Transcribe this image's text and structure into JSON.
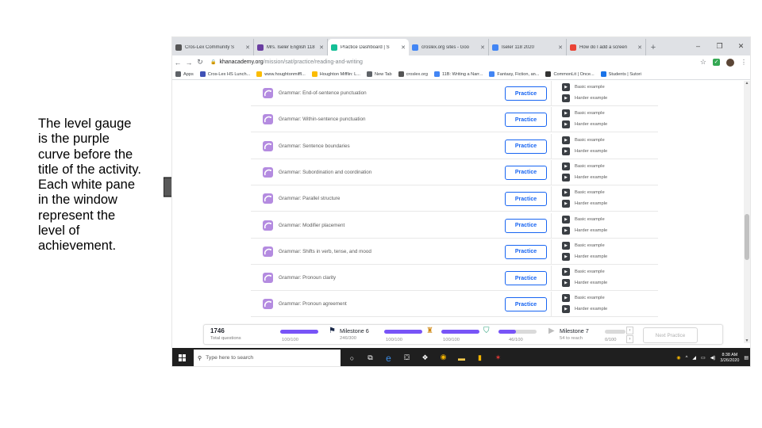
{
  "annotation": {
    "lines": [
      "The level gauge",
      "is the purple",
      "curve before the",
      "title of the activity.",
      "Each white pane",
      "in the window",
      "represent the",
      "level of",
      "achievement."
    ]
  },
  "browser": {
    "tabs": [
      {
        "title": "Cros-Lex Community S",
        "color": "#555555"
      },
      {
        "title": "Mrs. Iseler English 118",
        "color": "#6a3ea1"
      },
      {
        "title": "Practice Dashboard | S",
        "color": "#14bf96",
        "active": true
      },
      {
        "title": "croslex.org sites - Goo",
        "color": "#4285f4"
      },
      {
        "title": "Iseler 118 2020",
        "color": "#4285f4"
      },
      {
        "title": "How do I add a screen",
        "color": "#ea4335"
      }
    ],
    "new_tab": "+",
    "window_controls": [
      "–",
      "❐",
      "✕"
    ],
    "url_host": "khanacademy.org",
    "url_path": "/mission/sat/practice/reading-and-writing",
    "bookmarks": [
      {
        "label": "Apps",
        "color": "#5f6368"
      },
      {
        "label": "Cros-Lex HS Lunch...",
        "color": "#3f51b5"
      },
      {
        "label": "www.houghtonmiffl...",
        "color": "#fbbc04"
      },
      {
        "label": "Houghton Mifflin: L...",
        "color": "#fbbc04"
      },
      {
        "label": "New Tab",
        "color": "#5f6368"
      },
      {
        "label": "croslex.org",
        "color": "#555555"
      },
      {
        "label": "11B: Writing a Narr...",
        "color": "#4285f4"
      },
      {
        "label": "Fantasy, Fiction, an...",
        "color": "#4285f4"
      },
      {
        "label": "CommonLit | Once...",
        "color": "#333333"
      },
      {
        "label": "Students | Sutori",
        "color": "#1a73e8"
      }
    ]
  },
  "practice": {
    "button_label": "Practice",
    "example_basic": "Basic example",
    "example_harder": "Harder example",
    "skills": [
      "Grammar: End-of-sentence punctuation",
      "Grammar: Within-sentence punctuation",
      "Grammar: Sentence boundaries",
      "Grammar: Subordination and coordination",
      "Grammar: Parallel structure",
      "Grammar: Modifier placement",
      "Grammar: Shifts in verb, tense, and mood",
      "Grammar: Pronoun clarity",
      "Grammar: Pronoun agreement"
    ],
    "accent_color": "#1865f2",
    "level_color": "#b48be0"
  },
  "milestones": {
    "total": "1746",
    "total_label": "Total questions",
    "seg1_label": "100/100",
    "m6_title": "Milestone 6",
    "m6_sub": "246/300",
    "seg2_label": "100/100",
    "seg3_label": "100/100",
    "seg4_label": "46/100",
    "m7_title": "Milestone 7",
    "m7_sub": "54 to reach",
    "seg5_label": "0/100",
    "next_label": "Next Practice",
    "bar_color": "#7854f7",
    "seg4_progress": 0.46
  },
  "taskbar": {
    "search_placeholder": "Type here to search",
    "time": "8:38 AM",
    "date": "3/26/2020"
  }
}
